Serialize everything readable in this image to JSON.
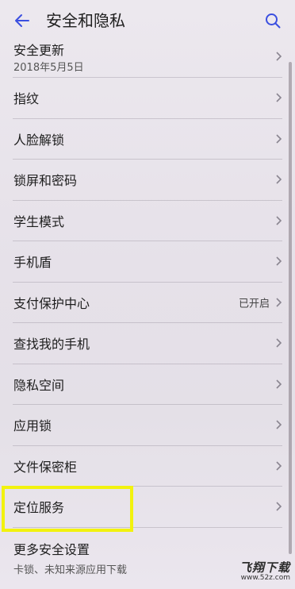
{
  "header": {
    "title": "安全和隐私",
    "back_icon": "back-arrow-icon",
    "search_icon": "search-icon",
    "accent": "#3b4fe0"
  },
  "items": [
    {
      "label": "安全更新",
      "sublabel": "2018年5月5日"
    },
    {
      "label": "指纹"
    },
    {
      "label": "人脸解锁"
    },
    {
      "label": "锁屏和密码"
    },
    {
      "label": "学生模式"
    },
    {
      "label": "手机盾"
    },
    {
      "label": "支付保护中心",
      "value": "已开启"
    },
    {
      "label": "查找我的手机"
    },
    {
      "label": "隐私空间"
    },
    {
      "label": "应用锁"
    },
    {
      "label": "文件保密柜"
    },
    {
      "label": "定位服务"
    },
    {
      "label": "更多安全设置",
      "sublabel": "卡锁、未知来源应用下载"
    }
  ],
  "highlight_color": "#f2f20e",
  "watermark": {
    "title": "飞翔下载",
    "url": "www.52z.com"
  }
}
